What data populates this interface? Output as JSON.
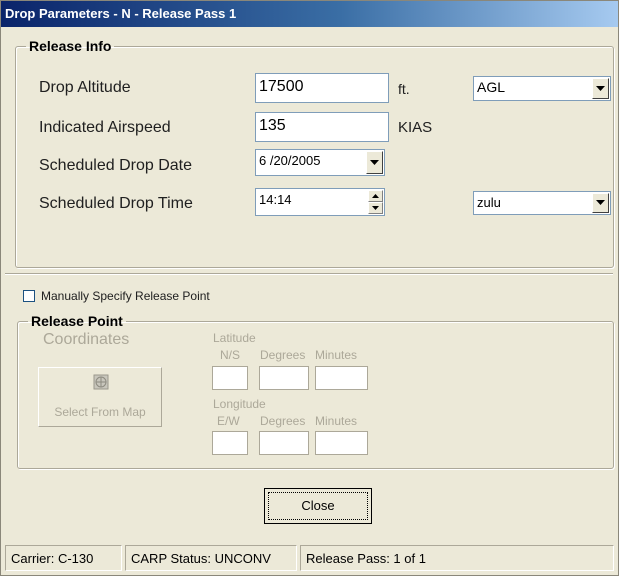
{
  "window": {
    "title": "Drop Parameters - N - Release Pass 1"
  },
  "release_info": {
    "legend": "Release Info",
    "drop_altitude": {
      "label": "Drop Altitude",
      "value": "17500",
      "unit": "ft.",
      "reference": "AGL"
    },
    "indicated_airspeed": {
      "label": "Indicated Airspeed",
      "value": "135",
      "unit": "KIAS"
    },
    "scheduled_drop_date": {
      "label": "Scheduled Drop Date",
      "value": "6 /20/2005"
    },
    "scheduled_drop_time": {
      "label": "Scheduled Drop Time",
      "value": "14:14",
      "timezone": "zulu"
    }
  },
  "manual_release": {
    "label": "Manually Specify Release Point",
    "checked": false
  },
  "release_point": {
    "legend": "Release Point",
    "coordinates_label": "Coordinates",
    "select_map_label": "Select From Map",
    "select_map_icon": "map-globe-icon",
    "latitude": {
      "label": "Latitude",
      "col1": "N/S",
      "col2": "Degrees",
      "col3": "Minutes"
    },
    "longitude": {
      "label": "Longitude",
      "col1": "E/W",
      "col2": "Degrees",
      "col3": "Minutes"
    }
  },
  "close_label": "Close",
  "status": {
    "carrier": "Carrier: C-130",
    "carp_status": "CARP Status: UNCONV",
    "release_pass": "Release Pass: 1 of 1"
  },
  "colors": {
    "title_bar": "#0a246a",
    "dialog_bg": "#ece9d8",
    "disabled_text": "#aca899"
  }
}
